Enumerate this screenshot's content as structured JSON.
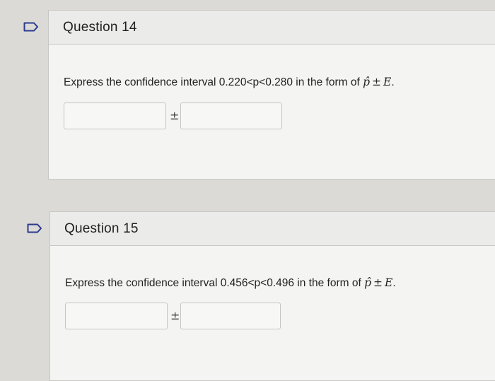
{
  "questions": [
    {
      "title": "Question 14",
      "prompt_text": "Express the confidence interval 0.220<p<0.280 in the form of ",
      "math_phat": "p̂",
      "math_pm": "±",
      "math_E": "E",
      "math_period": ".",
      "between_inputs": "±",
      "input_left_value": "",
      "input_right_value": ""
    },
    {
      "title": "Question 15",
      "prompt_text": "Express the confidence interval 0.456<p<0.496 in the form of ",
      "math_phat": "p̂",
      "math_pm": "±",
      "math_E": "E",
      "math_period": ".",
      "between_inputs": "±",
      "input_left_value": "",
      "input_right_value": ""
    }
  ],
  "colors": {
    "background": "#dcdad6",
    "card_body": "#f4f4f2",
    "card_header": "#ebebea",
    "flag_stroke": "#2a3b8f"
  },
  "icons": {
    "question_flag": "flag-icon"
  }
}
